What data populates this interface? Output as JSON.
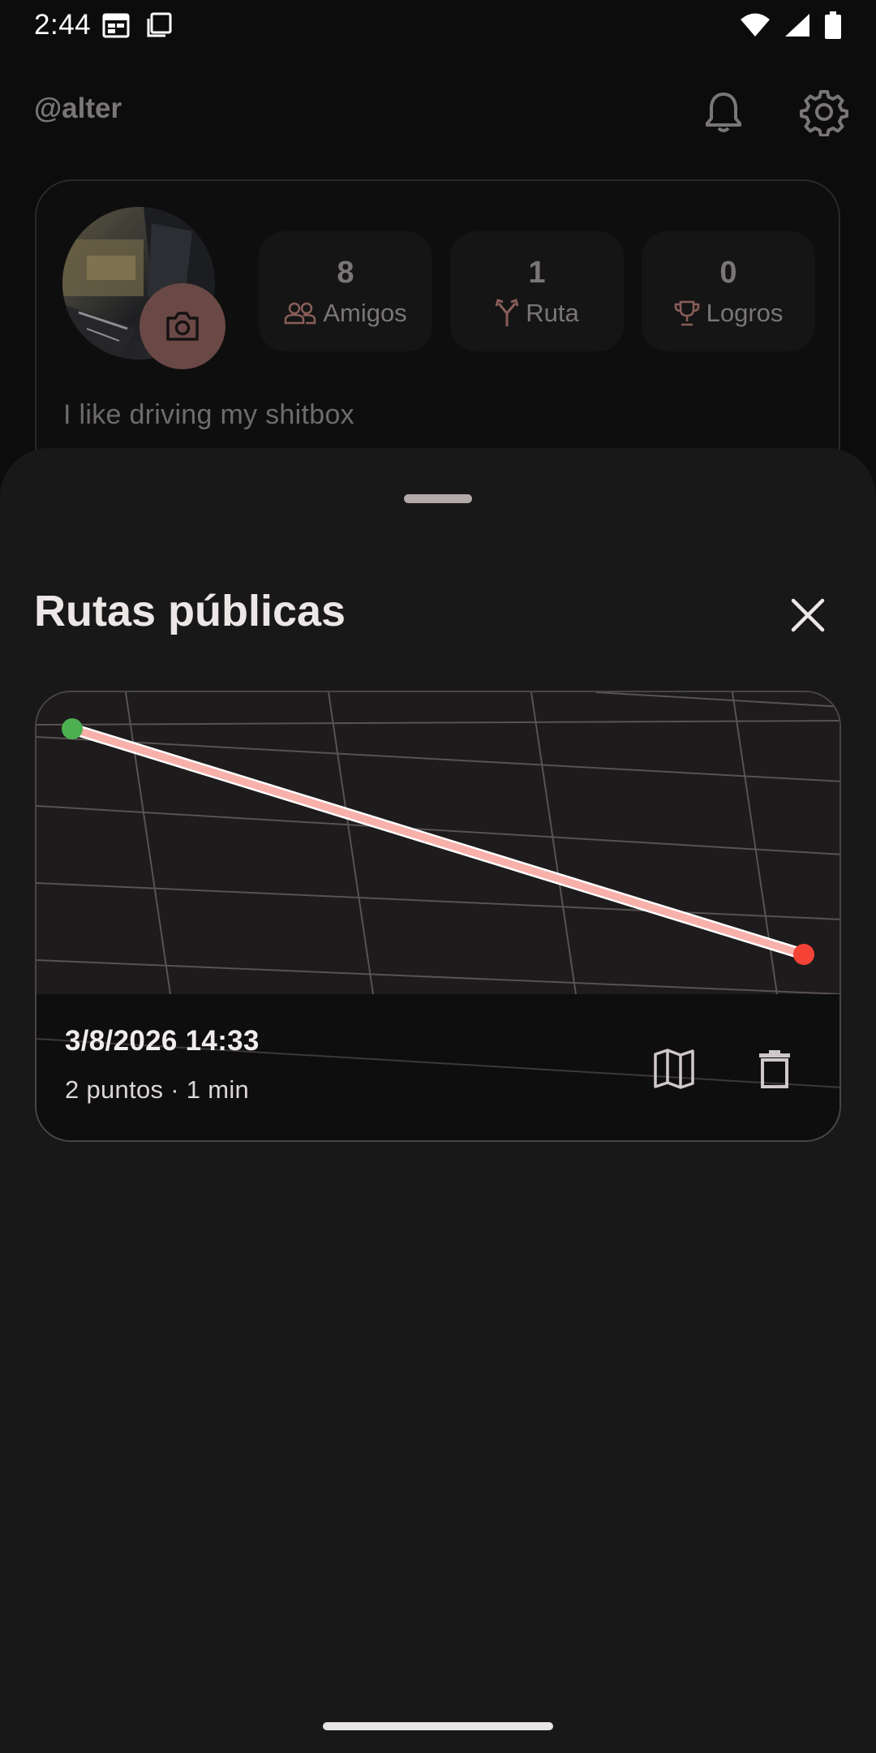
{
  "status_bar": {
    "time": "2:44",
    "left_icons": [
      "calendar-icon",
      "screen-icon"
    ],
    "right_icons": [
      "wifi-icon",
      "signal-icon",
      "battery-icon"
    ]
  },
  "profile": {
    "username": "@alter",
    "header_icons": [
      "bell-icon",
      "gear-icon"
    ],
    "stats": [
      {
        "value": "8",
        "label": "Amigos",
        "icon": "people-icon"
      },
      {
        "value": "1",
        "label": "Ruta",
        "icon": "route-fork-icon"
      },
      {
        "value": "0",
        "label": "Logros",
        "icon": "trophy-icon"
      }
    ],
    "bio": "I like driving my shitbox"
  },
  "sheet": {
    "title": "Rutas públicas",
    "routes": [
      {
        "date": "3/8/2026 14:33",
        "meta": "2 puntos · 1 min",
        "start_color": "#4caf50",
        "end_color": "#f44336",
        "path_color": "#f7b0aa"
      }
    ]
  },
  "colors": {
    "background": "#0c0c0c",
    "sheet": "#191818",
    "accent": "#6a4846"
  }
}
